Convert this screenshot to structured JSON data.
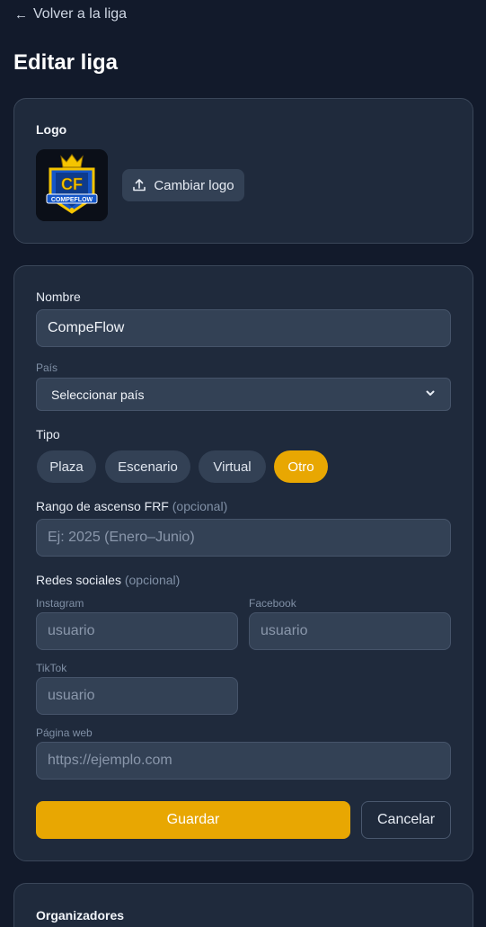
{
  "nav": {
    "back_label": "Volver a la liga"
  },
  "page": {
    "title": "Editar liga"
  },
  "logo_section": {
    "label": "Logo",
    "logo_text_big": "CF",
    "logo_text_small": "COMPEFLOW",
    "change_button": "Cambiar logo"
  },
  "form": {
    "name_label": "Nombre",
    "name_value": "CompeFlow",
    "country_label": "País",
    "country_value": "Seleccionar país",
    "type_label": "Tipo",
    "types": [
      {
        "label": "Plaza",
        "active": false
      },
      {
        "label": "Escenario",
        "active": false
      },
      {
        "label": "Virtual",
        "active": false
      },
      {
        "label": "Otro",
        "active": true
      }
    ],
    "rank_label": "Rango de ascenso FRF",
    "optional": "(opcional)",
    "rank_placeholder": "Ej: 2025 (Enero–Junio)",
    "social_label": "Redes sociales",
    "instagram_label": "Instagram",
    "instagram_placeholder": "usuario",
    "facebook_label": "Facebook",
    "facebook_placeholder": "usuario",
    "tiktok_label": "TikTok",
    "tiktok_placeholder": "usuario",
    "web_label": "Página web",
    "web_placeholder": "https://ejemplo.com",
    "save_button": "Guardar",
    "cancel_button": "Cancelar"
  },
  "organizers": {
    "label": "Organizadores"
  },
  "colors": {
    "accent": "#e8a702",
    "card": "#1f2a3c",
    "background": "#121a2b"
  }
}
